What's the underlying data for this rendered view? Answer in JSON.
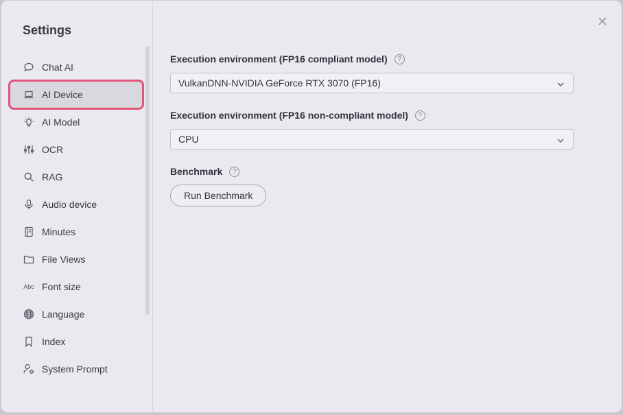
{
  "sidebar": {
    "title": "Settings",
    "items": [
      {
        "label": "Chat AI",
        "icon": "chat-bubble-icon"
      },
      {
        "label": "AI Device",
        "icon": "laptop-icon",
        "active": true
      },
      {
        "label": "AI Model",
        "icon": "lightbulb-icon"
      },
      {
        "label": "OCR",
        "icon": "sliders-icon"
      },
      {
        "label": "RAG",
        "icon": "search-icon"
      },
      {
        "label": "Audio device",
        "icon": "microphone-icon"
      },
      {
        "label": "Minutes",
        "icon": "notebook-icon"
      },
      {
        "label": "File Views",
        "icon": "folder-icon"
      },
      {
        "label": "Font size",
        "icon": "font-size-icon",
        "glyph": "Abc"
      },
      {
        "label": "Language",
        "icon": "globe-icon"
      },
      {
        "label": "Index",
        "icon": "bookmark-icon"
      },
      {
        "label": "System Prompt",
        "icon": "user-gear-icon"
      }
    ]
  },
  "main": {
    "fp16": {
      "label": "Execution environment (FP16 compliant model)",
      "value": "VulkanDNN-NVIDIA GeForce RTX 3070 (FP16)"
    },
    "non_fp16": {
      "label": "Execution environment (FP16 non-compliant model)",
      "value": "CPU"
    },
    "benchmark": {
      "label": "Benchmark",
      "button": "Run Benchmark"
    },
    "help_glyph": "?"
  },
  "colors": {
    "active_outline": "#e0557a",
    "background": "#eae9f0"
  }
}
